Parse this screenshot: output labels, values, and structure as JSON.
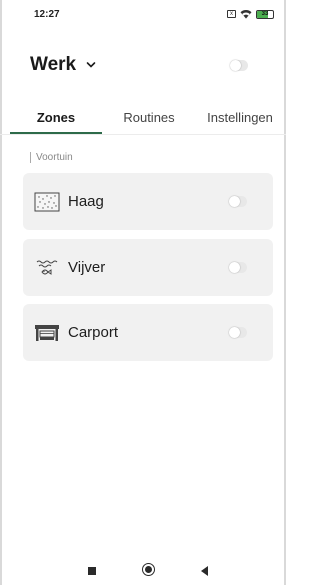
{
  "status_bar": {
    "time": "12:27",
    "sim_icon_text": "x",
    "battery_level": "33",
    "battery_color": "#4caf50",
    "icons": [
      "sim-card-icon",
      "wifi-icon",
      "battery-icon"
    ]
  },
  "header": {
    "title": "Werk",
    "dropdown_icon": "chevron-down-icon",
    "master_toggle_on": false
  },
  "tabs": [
    {
      "label": "Zones",
      "active": true
    },
    {
      "label": "Routines",
      "active": false
    },
    {
      "label": "Instellingen",
      "active": false
    }
  ],
  "accent_color": "#2e6b4a",
  "section": {
    "label": "Voortuin",
    "zones": [
      {
        "label": "Haag",
        "icon": "hedge-icon",
        "enabled": false
      },
      {
        "label": "Vijver",
        "icon": "pond-icon",
        "enabled": false
      },
      {
        "label": "Carport",
        "icon": "carport-icon",
        "enabled": false
      }
    ]
  },
  "nav_bar": {
    "buttons": [
      "recent-apps-button",
      "home-button",
      "back-button"
    ]
  }
}
